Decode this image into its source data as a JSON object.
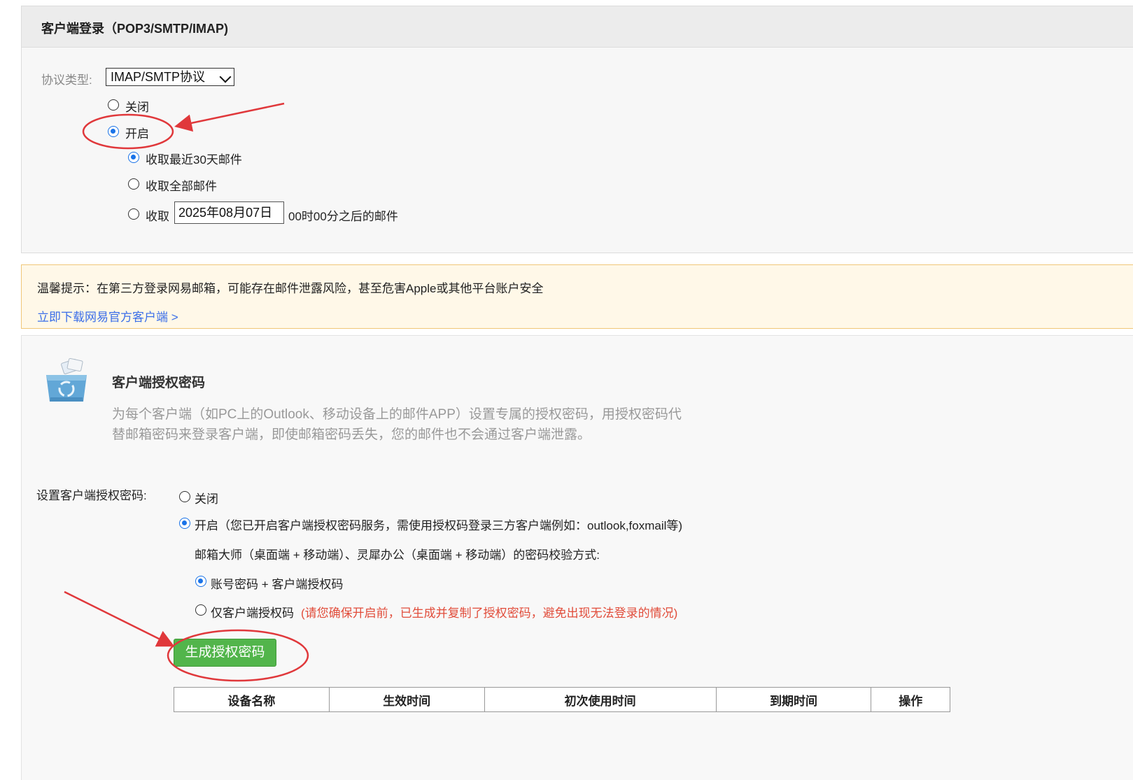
{
  "imap_section": {
    "title": "客户端登录（POP3/SMTP/IMAP)",
    "protocol_label": "协议类型:",
    "protocol_selected": "IMAP/SMTP协议",
    "options": [
      {
        "label": "关闭",
        "checked": false
      },
      {
        "label": "开启",
        "checked": true
      }
    ],
    "fetch_options": [
      {
        "label": "收取最近30天邮件",
        "checked": true
      },
      {
        "label": "收取全部邮件",
        "checked": false
      }
    ],
    "fetch_after": {
      "prefix": "收取",
      "date": "2025年08月07日",
      "suffix": "00时00分之后的邮件",
      "checked": false
    }
  },
  "notice": {
    "text": "温馨提示：在第三方登录网易邮箱，可能存在邮件泄露风险，甚至危害Apple或其他平台账户安全",
    "link": "立即下载网易官方客户端 >"
  },
  "auth_section": {
    "title": "客户端授权密码",
    "description": "为每个客户端（如PC上的Outlook、移动设备上的邮件APP）设置专属的授权密码，用授权密码代替邮箱密码来登录客户端，即使邮箱密码丢失，您的邮件也不会通过客户端泄露。",
    "icon": "recycle-box-icon"
  },
  "auth_settings": {
    "label": "设置客户端授权密码:",
    "off_label": "关闭",
    "on_label": "开启（您已开启客户端授权密码服务，需使用授权码登录三方客户端例如：outlook,foxmail等)",
    "verify_title": "邮箱大师（桌面端 + 移动端）、灵犀办公（桌面端 + 移动端）的密码校验方式:",
    "verify_options": [
      {
        "label": "账号密码 + 客户端授权码",
        "checked": true
      },
      {
        "label": "仅客户端授权码",
        "checked": false
      }
    ],
    "warning": "(请您确保开启前，已生成并复制了授权密码，避免出现无法登录的情况)",
    "generate_button": "生成授权密码",
    "table_headers": [
      "设备名称",
      "生效时间",
      "初次使用时间",
      "到期时间",
      "操作"
    ]
  },
  "colors": {
    "accent_blue": "#1a73e8",
    "button_green": "#52b54b",
    "annotation_red": "#e0383b",
    "notice_bg": "#fff8e8"
  }
}
